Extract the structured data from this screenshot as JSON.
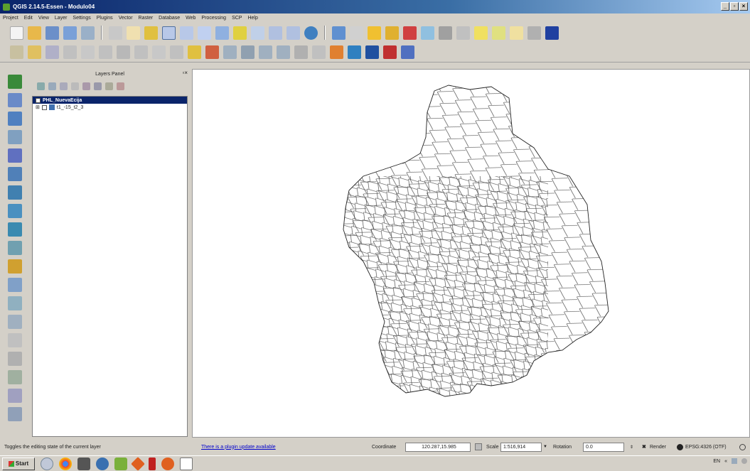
{
  "window": {
    "title": "QGIS 2.14.5-Essen - Modulo04"
  },
  "menu": [
    "Project",
    "Edit",
    "View",
    "Layer",
    "Settings",
    "Plugins",
    "Vector",
    "Raster",
    "Database",
    "Web",
    "Processing",
    "SCP",
    "Help"
  ],
  "layers_panel": {
    "title": "Layers Panel",
    "items": [
      {
        "name": "PHL_NuevaEcija",
        "selected": true
      },
      {
        "name": "t1_-15_t2_3",
        "selected": false
      }
    ]
  },
  "status": {
    "message": "Toggles the editing state of the current layer",
    "plugin_update_link": "There is a plugin update available",
    "coordinate_label": "Coordinate",
    "coordinate_value": "120.287,15.985",
    "scale_label": "Scale",
    "scale_value": "1:516,914",
    "rotation_label": "Rotation",
    "rotation_value": "0.0",
    "render_label": "Render",
    "crs": "EPSG:4326 (OTF)"
  },
  "taskbar": {
    "start_label": "Start",
    "language": "EN"
  },
  "colors": {
    "title_start": "#0a246a",
    "selected_layer": "#0a246a",
    "chrome": "#d4d0c8"
  }
}
